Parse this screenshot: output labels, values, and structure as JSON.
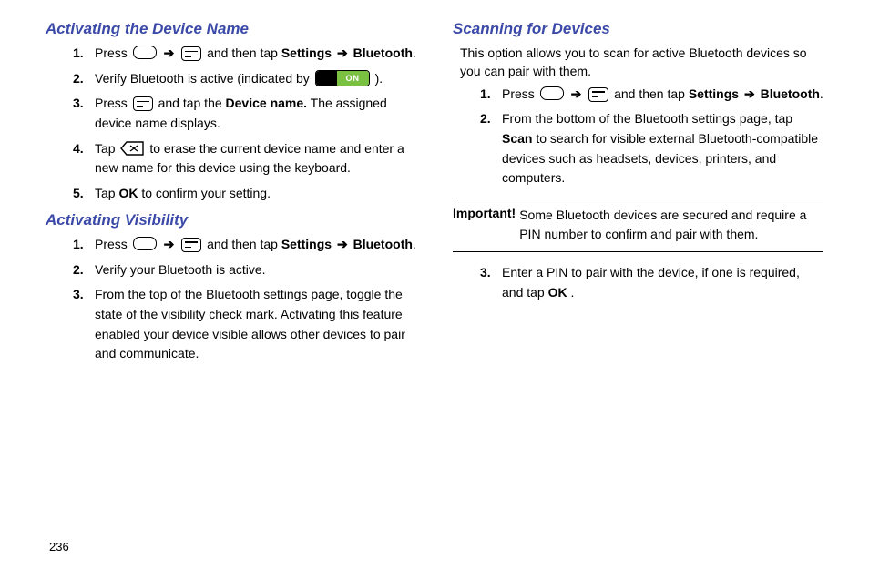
{
  "pageNumber": "236",
  "onLabel": "ON",
  "arrow": "➔",
  "left": {
    "s1": {
      "title": "Activating the Device Name",
      "steps": [
        {
          "n": "1.",
          "pre": "Press ",
          "mid": " and then tap ",
          "bold1": "Settings ",
          "bold2": "Bluetooth",
          "post": "."
        },
        {
          "n": "2.",
          "a": "Verify Bluetooth is active (indicated by ",
          "b": ")."
        },
        {
          "n": "3.",
          "a": "Press ",
          "b": " and tap the ",
          "bold": "Device name.",
          "c": " The assigned device name displays."
        },
        {
          "n": "4.",
          "a": "Tap ",
          "b": " to erase the current device name and enter a new name for this device using the keyboard."
        },
        {
          "n": "5.",
          "a": "Tap ",
          "bold": "OK",
          "b": " to confirm your setting."
        }
      ]
    },
    "s2": {
      "title": "Activating Visibility",
      "steps": [
        {
          "n": "1.",
          "pre": "Press ",
          "mid": " and then tap ",
          "bold1": "Settings ",
          "bold2": "Bluetooth",
          "post": "."
        },
        {
          "n": "2.",
          "t": "Verify your Bluetooth is active."
        },
        {
          "n": "3.",
          "t": "From the top of the Bluetooth settings page, toggle the state of the visibility check mark. Activating this feature enabled your device visible allows other devices to pair and communicate."
        }
      ]
    }
  },
  "right": {
    "s1": {
      "title": "Scanning for Devices",
      "intro": "This option allows you to scan for active Bluetooth devices so you can pair with them.",
      "steps": [
        {
          "n": "1.",
          "pre": "Press ",
          "mid": " and then tap ",
          "bold1": "Settings ",
          "bold2": "Bluetooth",
          "post": "."
        },
        {
          "n": "2.",
          "a": "From the bottom of the Bluetooth settings page, tap ",
          "bold": "Scan",
          "b": " to search for visible external Bluetooth-compatible devices such as headsets, devices, printers, and computers."
        }
      ],
      "importantLabel": "Important!",
      "importantText": "Some Bluetooth devices are secured and require a PIN number to confirm and pair with them.",
      "steps2": [
        {
          "n": "3.",
          "a": "Enter a PIN to pair with the device, if one is required, and tap ",
          "bold": "OK",
          "b": "."
        }
      ]
    }
  }
}
